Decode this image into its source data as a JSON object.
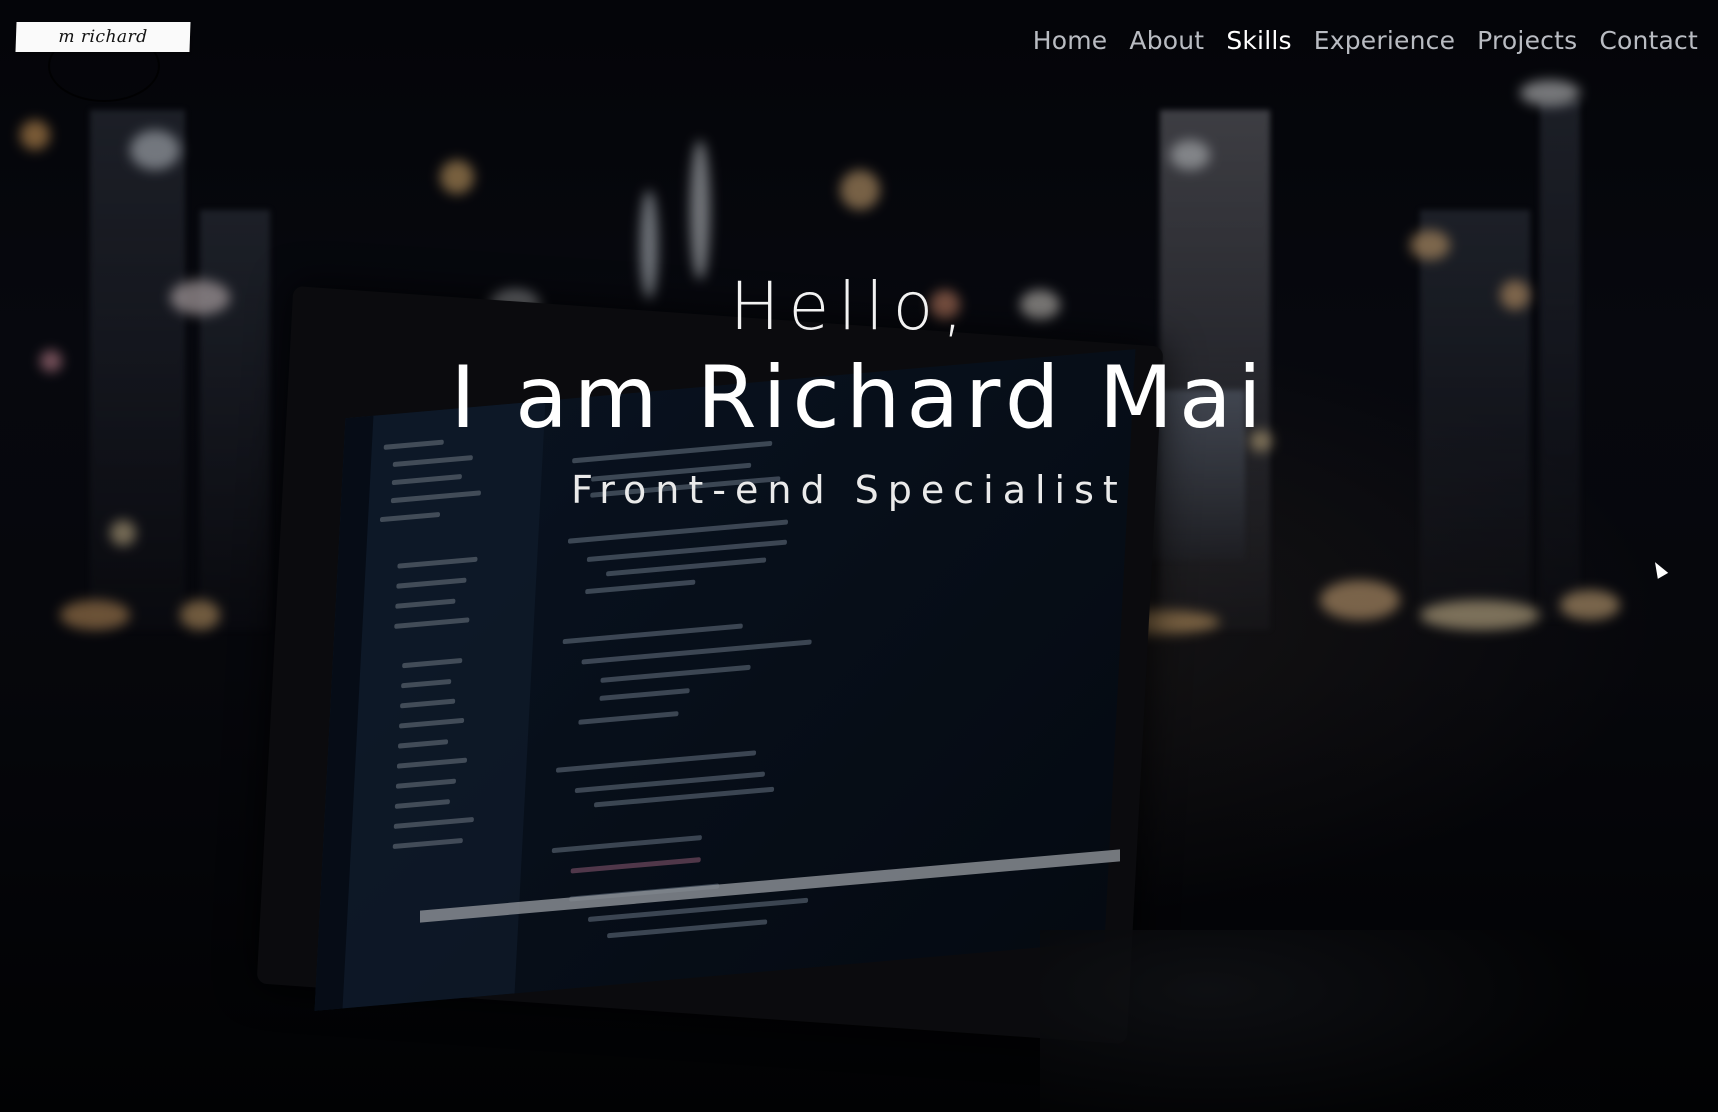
{
  "header": {
    "logo_text": "m richard",
    "nav": [
      {
        "label": "Home",
        "active": false
      },
      {
        "label": "About",
        "active": false
      },
      {
        "label": "Skills",
        "active": true
      },
      {
        "label": "Experience",
        "active": false
      },
      {
        "label": "Projects",
        "active": false
      },
      {
        "label": "Contact",
        "active": false
      }
    ]
  },
  "hero": {
    "greeting": "Hello,",
    "name": "I am Richard Mai",
    "role": "Front-end Specialist"
  },
  "colors": {
    "nav_default": "#b9bcc2",
    "nav_active": "#ffffff",
    "text": "#ffffff",
    "logo_bg": "#fafafa"
  }
}
